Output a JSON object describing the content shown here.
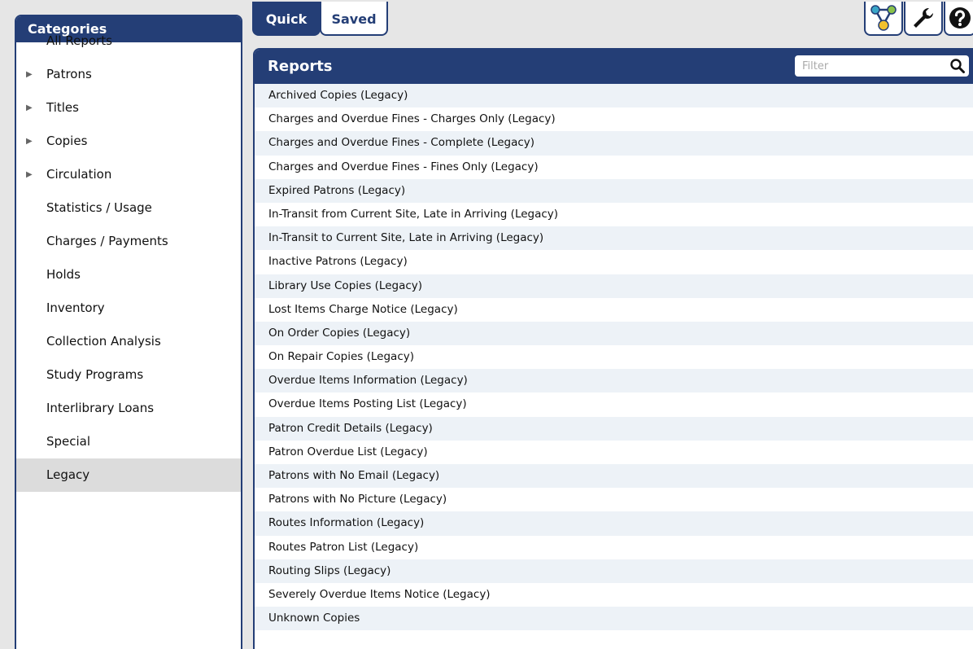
{
  "tabs": {
    "quick": "Quick",
    "saved": "Saved"
  },
  "toolbar": {
    "icons": [
      "network-tool-icon",
      "wrench-icon",
      "help-icon"
    ],
    "colors": {
      "accent": "#243e76",
      "icon_green": "#8bc34a",
      "icon_yellow": "#f2c12e",
      "icon_teal": "#3aa6c8"
    }
  },
  "categories": {
    "title": "Categories",
    "items": [
      {
        "label": "All Reports",
        "expandable": false,
        "selected": false
      },
      {
        "label": "Patrons",
        "expandable": true,
        "selected": false
      },
      {
        "label": "Titles",
        "expandable": true,
        "selected": false
      },
      {
        "label": "Copies",
        "expandable": true,
        "selected": false
      },
      {
        "label": "Circulation",
        "expandable": true,
        "selected": false
      },
      {
        "label": "Statistics / Usage",
        "expandable": false,
        "selected": false
      },
      {
        "label": "Charges / Payments",
        "expandable": false,
        "selected": false
      },
      {
        "label": "Holds",
        "expandable": false,
        "selected": false
      },
      {
        "label": "Inventory",
        "expandable": false,
        "selected": false
      },
      {
        "label": "Collection Analysis",
        "expandable": false,
        "selected": false
      },
      {
        "label": "Study Programs",
        "expandable": false,
        "selected": false
      },
      {
        "label": "Interlibrary Loans",
        "expandable": false,
        "selected": false
      },
      {
        "label": "Special",
        "expandable": false,
        "selected": false
      },
      {
        "label": "Legacy",
        "expandable": false,
        "selected": true
      }
    ]
  },
  "reports": {
    "title": "Reports",
    "filter_placeholder": "Filter",
    "items": [
      "Archived Copies (Legacy)",
      "Charges and Overdue Fines - Charges Only (Legacy)",
      "Charges and Overdue Fines - Complete (Legacy)",
      "Charges and Overdue Fines - Fines Only (Legacy)",
      "Expired Patrons (Legacy)",
      "In-Transit from Current Site, Late in Arriving (Legacy)",
      "In-Transit to Current Site, Late in Arriving (Legacy)",
      "Inactive Patrons (Legacy)",
      "Library Use Copies (Legacy)",
      "Lost Items Charge Notice (Legacy)",
      "On Order Copies (Legacy)",
      "On Repair Copies (Legacy)",
      "Overdue Items Information (Legacy)",
      "Overdue Items Posting List (Legacy)",
      "Patron Credit Details (Legacy)",
      "Patron Overdue List (Legacy)",
      "Patrons with No Email (Legacy)",
      "Patrons with No Picture (Legacy)",
      "Routes Information (Legacy)",
      "Routes Patron List (Legacy)",
      "Routing Slips (Legacy)",
      "Severely Overdue Items Notice (Legacy)",
      "Unknown Copies"
    ]
  }
}
